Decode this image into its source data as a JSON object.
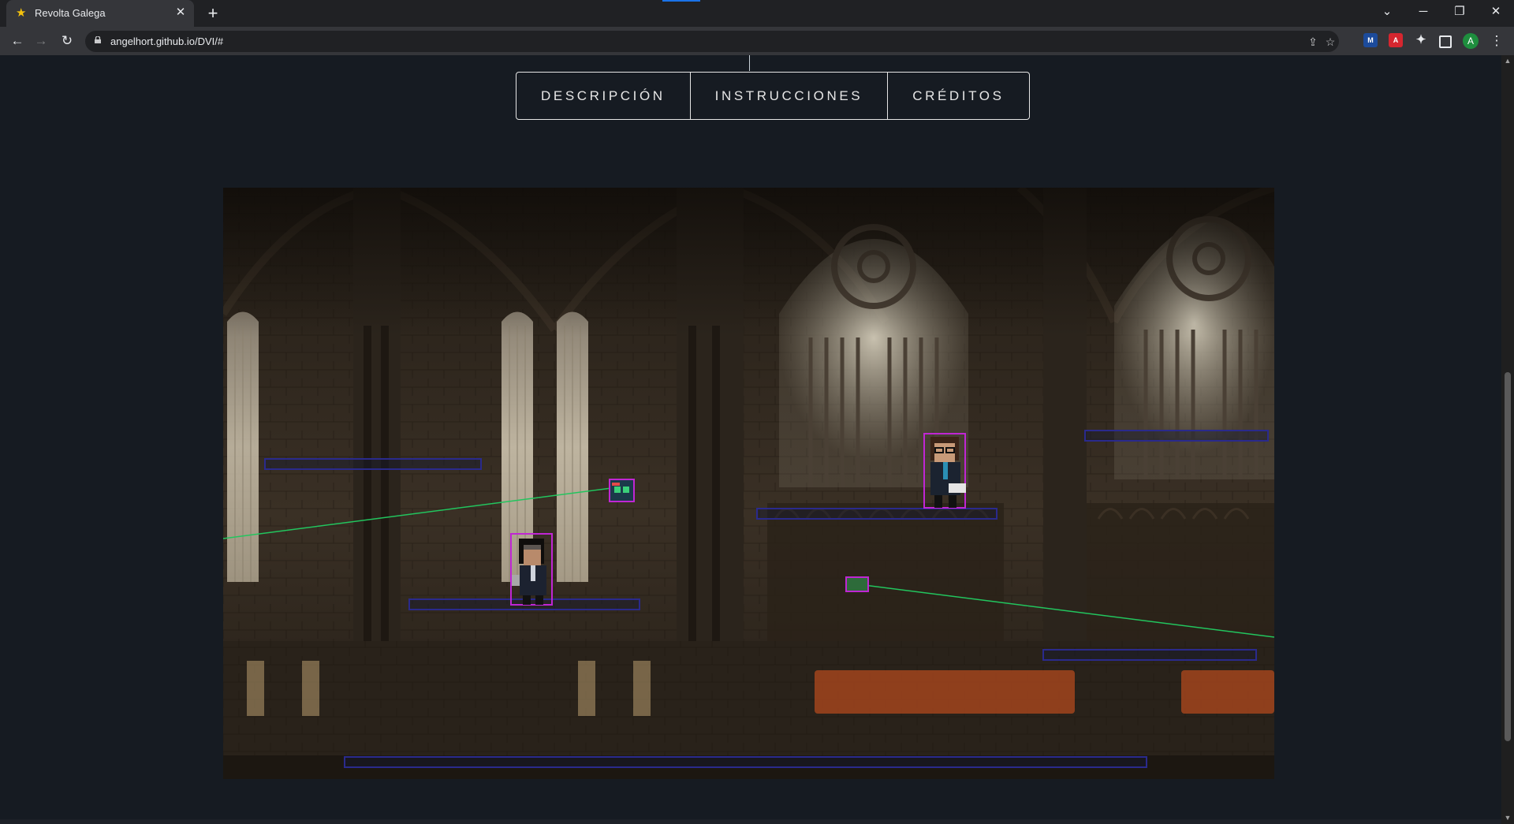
{
  "browser": {
    "tab_title": "Revolta Galega",
    "url": "angelhort.github.io/DVI/#",
    "profile_initial": "A",
    "extensions": [
      "mendeley-icon",
      "acrobat-icon",
      "puzzle-icon",
      "sidepanel-icon"
    ]
  },
  "nav": {
    "items": [
      {
        "label": "DESCRIPCIÓN"
      },
      {
        "label": "INSTRUCCIONES"
      },
      {
        "label": "CRÉDITOS"
      }
    ]
  },
  "game": {
    "title": "Revolta Galega",
    "debug_colors": {
      "platform": "#2a2a8c",
      "player_box": "#c026d3",
      "ray": "#22c55e"
    }
  }
}
